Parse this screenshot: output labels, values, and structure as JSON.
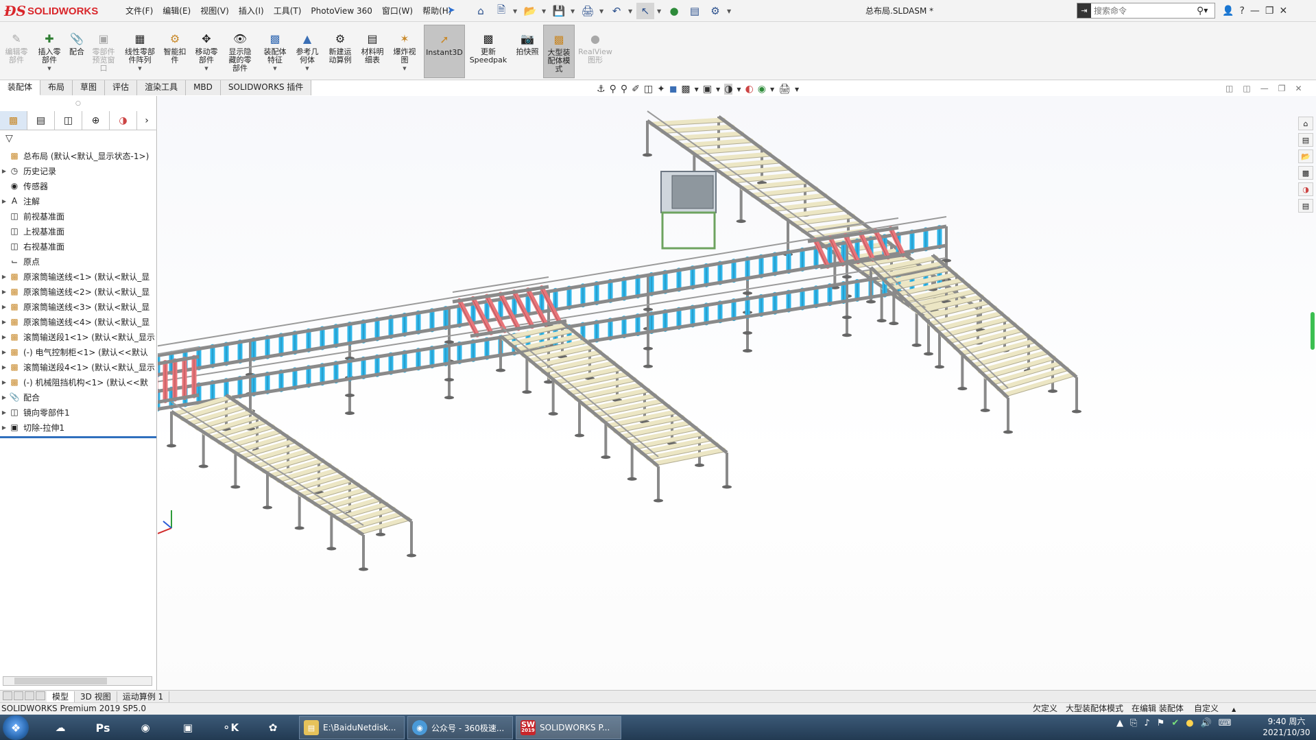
{
  "app": {
    "logo_text": "SOLIDWORKS",
    "doc_title": "总布局.SLDASM *"
  },
  "menu": [
    "文件(F)",
    "编辑(E)",
    "视图(V)",
    "插入(I)",
    "工具(T)",
    "PhotoView 360",
    "窗口(W)",
    "帮助(H)"
  ],
  "search": {
    "placeholder": "搜索命令"
  },
  "commands": [
    {
      "label": "编辑零\n部件",
      "icon": "edit-component-icon",
      "enabled": false
    },
    {
      "label": "插入零\n部件",
      "icon": "insert-component-icon",
      "enabled": true
    },
    {
      "label": "配合",
      "icon": "mate-icon",
      "enabled": true
    },
    {
      "label": "零部件\n预览窗\n口",
      "icon": "preview-window-icon",
      "enabled": false
    },
    {
      "label": "线性零部\n件阵列",
      "icon": "linear-pattern-icon",
      "enabled": true
    },
    {
      "label": "智能扣\n件",
      "icon": "smart-fastener-icon",
      "enabled": true
    },
    {
      "label": "移动零\n部件",
      "icon": "move-component-icon",
      "enabled": true
    },
    {
      "label": "显示隐\n藏的零\n部件",
      "icon": "show-hidden-icon",
      "enabled": true
    },
    {
      "label": "装配体\n特征",
      "icon": "assembly-feature-icon",
      "enabled": true
    },
    {
      "label": "参考几\n何体",
      "icon": "reference-geometry-icon",
      "enabled": true
    },
    {
      "label": "新建运\n动算例",
      "icon": "motion-study-icon",
      "enabled": true
    },
    {
      "label": "材料明\n细表",
      "icon": "bom-icon",
      "enabled": true
    },
    {
      "label": "爆炸视\n图",
      "icon": "exploded-view-icon",
      "enabled": true
    },
    {
      "label": "Instant3D",
      "icon": "instant3d-icon",
      "enabled": true,
      "active": true
    },
    {
      "label": "更新\nSpeedpak",
      "icon": "speedpak-icon",
      "enabled": true
    },
    {
      "label": "拍快照",
      "icon": "snapshot-icon",
      "enabled": true
    },
    {
      "label": "大型装\n配体模\n式",
      "icon": "large-assembly-icon",
      "enabled": true,
      "active": true
    },
    {
      "label": "RealView\n图形",
      "icon": "realview-icon",
      "enabled": false
    }
  ],
  "tabs": [
    "装配体",
    "布局",
    "草图",
    "评估",
    "渲染工具",
    "MBD",
    "SOLIDWORKS 插件"
  ],
  "tree": {
    "root": "总布局  (默认<默认_显示状态-1>)",
    "items": [
      {
        "label": "历史记录",
        "icon": "history-icon",
        "expand": true
      },
      {
        "label": "传感器",
        "icon": "sensor-icon",
        "expand": false
      },
      {
        "label": "注解",
        "icon": "annotation-icon",
        "expand": true
      },
      {
        "label": "前视基准面",
        "icon": "plane-icon",
        "expand": false
      },
      {
        "label": "上视基准面",
        "icon": "plane-icon",
        "expand": false
      },
      {
        "label": "右视基准面",
        "icon": "plane-icon",
        "expand": false
      },
      {
        "label": "原点",
        "icon": "origin-icon",
        "expand": false
      },
      {
        "label": "原滚筒输送线<1> (默认<默认_显",
        "icon": "assembly-icon",
        "expand": true
      },
      {
        "label": "原滚筒输送线<2> (默认<默认_显",
        "icon": "assembly-icon",
        "expand": true
      },
      {
        "label": "原滚筒输送线<3> (默认<默认_显",
        "icon": "assembly-icon",
        "expand": true
      },
      {
        "label": "原滚筒输送线<4> (默认<默认_显",
        "icon": "assembly-icon",
        "expand": true
      },
      {
        "label": "滚筒输送段1<1> (默认<默认_显示",
        "icon": "assembly-icon",
        "expand": true
      },
      {
        "label": "(-) 电气控制柜<1> (默认<<默认",
        "icon": "assembly-icon",
        "expand": true
      },
      {
        "label": "滚筒输送段4<1> (默认<默认_显示",
        "icon": "assembly-icon",
        "expand": true
      },
      {
        "label": "(-) 机械阻挡机构<1> (默认<<默",
        "icon": "assembly-icon",
        "expand": true
      },
      {
        "label": "配合",
        "icon": "mates-folder-icon",
        "expand": true
      },
      {
        "label": "镜向零部件1",
        "icon": "mirror-icon",
        "expand": true
      },
      {
        "label": "切除-拉伸1",
        "icon": "cut-extrude-icon",
        "expand": true
      }
    ]
  },
  "bottom_tabs": [
    "模型",
    "3D 视图",
    "运动算例 1"
  ],
  "status": {
    "left": "SOLIDWORKS Premium 2019 SP5.0",
    "items": [
      "欠定义",
      "大型装配体模式",
      "在编辑 装配体"
    ],
    "units": "自定义"
  },
  "taskbar": {
    "tasks": [
      "E:\\BaiduNetdisk...",
      "公众号 - 360极速...",
      "SOLIDWORKS P..."
    ],
    "sw_badge": "2019",
    "time": "9:40 周六",
    "date": "2021/10/30"
  },
  "colors": {
    "brand": "#d9262b",
    "frame": "#8a8a8a",
    "roller_cream": "#ece6c4",
    "roller_blue": "#2fb6ea",
    "roller_red": "#e8757a",
    "tree_accent": "#2f6fbd"
  }
}
